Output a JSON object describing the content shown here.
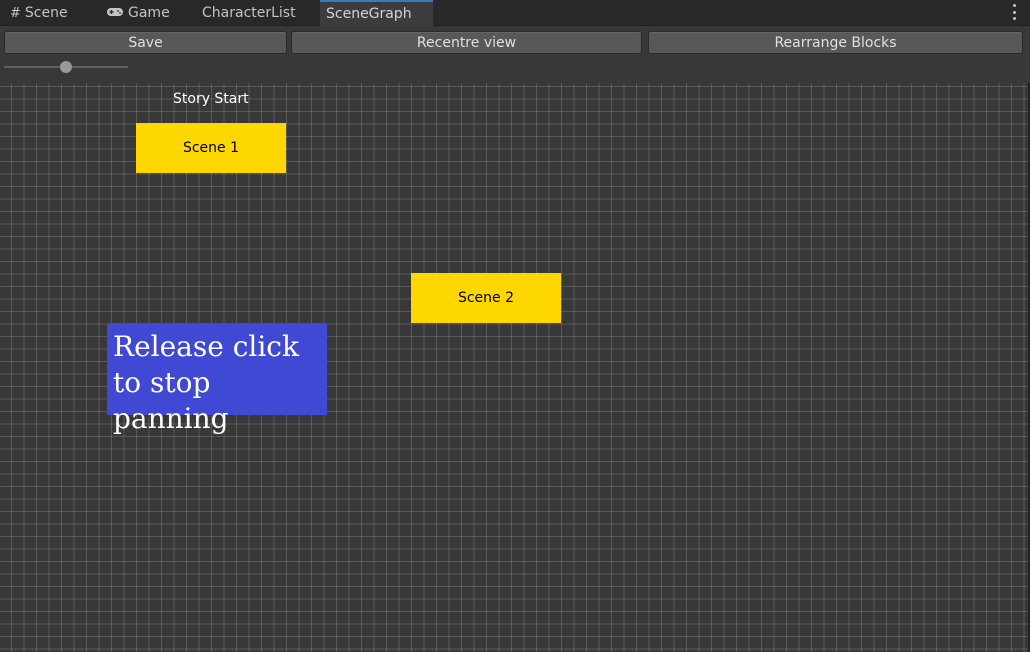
{
  "tabs": [
    {
      "label": "Scene",
      "icon": "grid-icon"
    },
    {
      "label": "Game",
      "icon": "gamepad-icon"
    },
    {
      "label": "CharacterList"
    },
    {
      "label": "SceneGraph",
      "active": true
    }
  ],
  "toolbar": {
    "save_label": "Save",
    "recentre_label": "Recentre view",
    "rearrange_label": "Rearrange Blocks",
    "zoom_slider_value": 0.5
  },
  "graph": {
    "story_start_label": "Story Start",
    "nodes": [
      {
        "label": "Scene 1"
      },
      {
        "label": "Scene 2"
      }
    ],
    "tooltip_line1": "Release click",
    "tooltip_line2": "to stop panning"
  },
  "colors": {
    "scene_block": "#ffd700",
    "tooltip_bg": "#4049d4",
    "active_tab_accent": "#3a79bb",
    "canvas_bg": "#383838"
  }
}
